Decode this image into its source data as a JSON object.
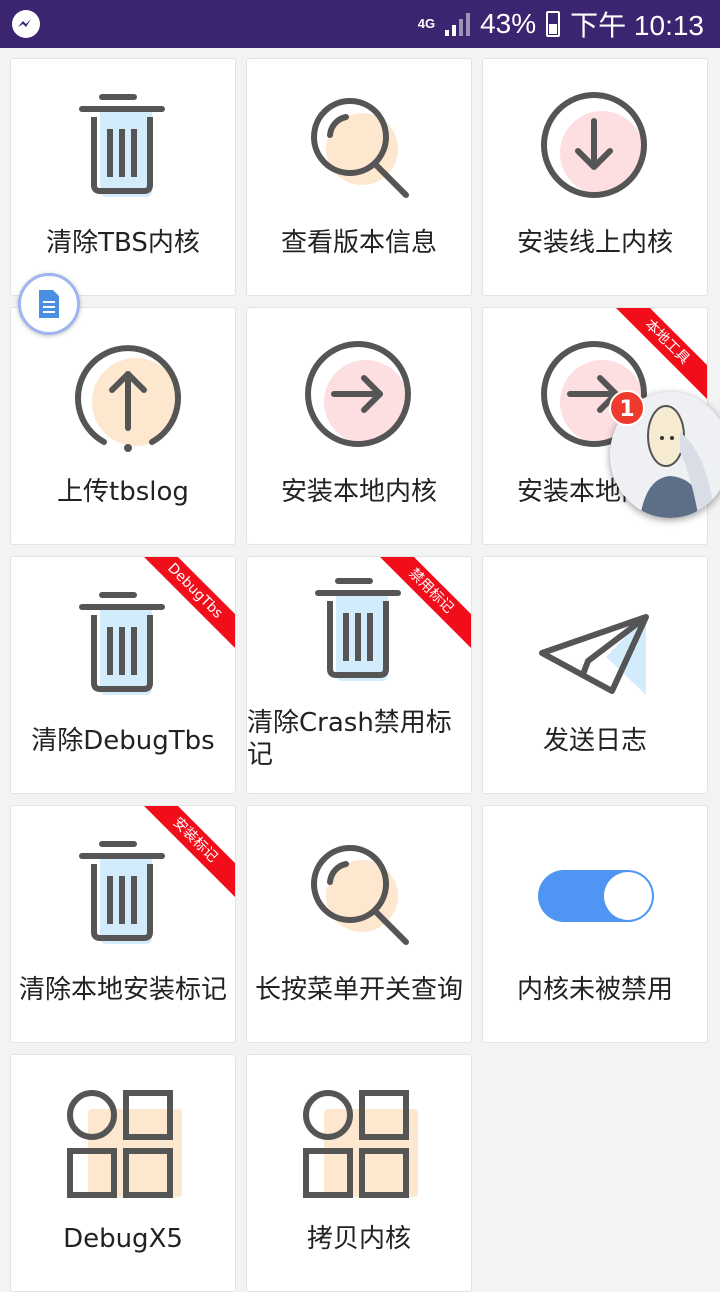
{
  "status_bar": {
    "network": "4G",
    "battery": "43%",
    "time": "下午 10:13"
  },
  "items": [
    {
      "label": "清除TBS内核",
      "icon": "trash-icon"
    },
    {
      "label": "查看版本信息",
      "icon": "search-icon"
    },
    {
      "label": "安装线上内核",
      "icon": "download-icon"
    },
    {
      "label": "上传tbslog",
      "icon": "upload-icon"
    },
    {
      "label": "安装本地内核",
      "icon": "arrow-right-icon"
    },
    {
      "label": "安装本地内核",
      "icon": "arrow-right-icon",
      "ribbon": "本地工具"
    },
    {
      "label": "清除DebugTbs",
      "icon": "trash-icon",
      "ribbon": "DebugTbs"
    },
    {
      "label": "清除Crash禁用标记",
      "icon": "trash-icon",
      "ribbon": "禁用标记"
    },
    {
      "label": "发送日志",
      "icon": "send-icon"
    },
    {
      "label": "清除本地安装标记",
      "icon": "trash-icon",
      "ribbon": "安装标记"
    },
    {
      "label": "长按菜单开关查询",
      "icon": "search-icon"
    },
    {
      "label": "内核未被禁用",
      "icon": "toggle-on-icon"
    },
    {
      "label": "DebugX5",
      "icon": "grid-icon"
    },
    {
      "label": "拷贝内核",
      "icon": "grid-icon"
    }
  ],
  "floating": {
    "badge_count": "1"
  },
  "colors": {
    "accent_blue": "#d3ecfb",
    "accent_orange": "#fde8cf",
    "accent_pink": "#fddfe2",
    "ribbon_red": "#f20d1b",
    "status_bar": "#3b2470"
  }
}
